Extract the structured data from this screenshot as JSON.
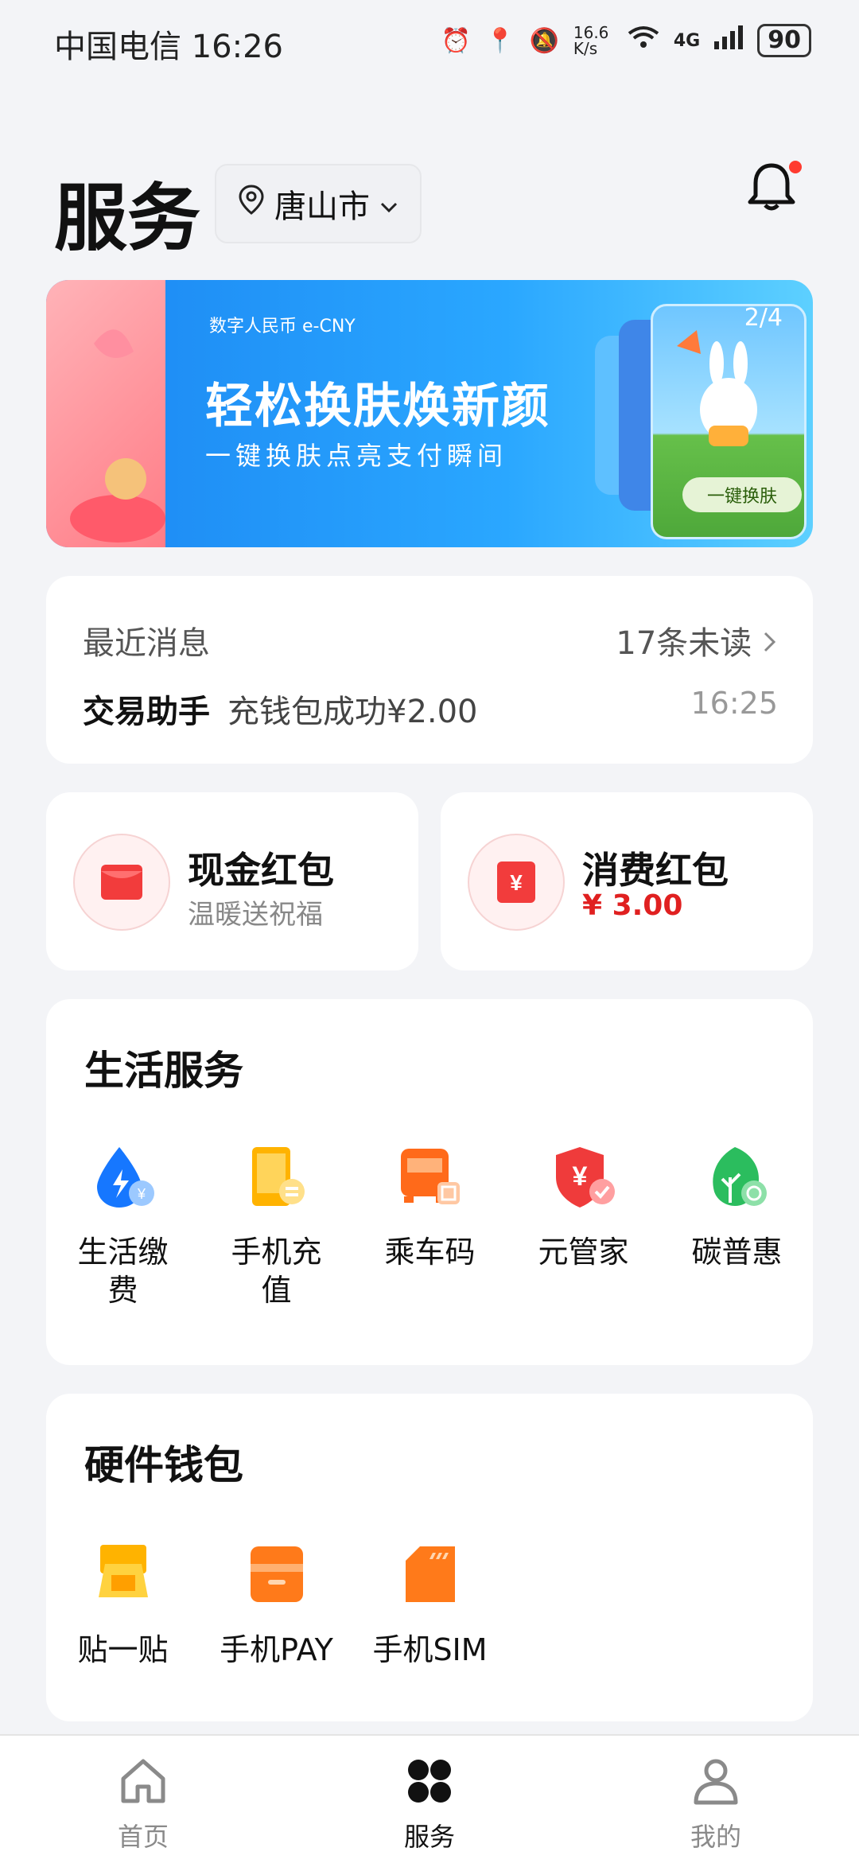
{
  "status_bar": {
    "carrier_time": "中国电信 16:26",
    "net_speed": "16.6 K/s",
    "signal": "4G",
    "battery": "90"
  },
  "header": {
    "title": "服务",
    "city": "唐山市"
  },
  "banner": {
    "brand": "数字人民币 e-CNY",
    "headline": "轻松换肤焕新颜",
    "subline": "一键换肤点亮支付瞬间",
    "pager": "2/4",
    "cta": "一键换肤"
  },
  "messages": {
    "label": "最近消息",
    "unread": "17条未读",
    "sender": "交易助手",
    "content": "充钱包成功¥2.00",
    "time": "16:25"
  },
  "red_packets": [
    {
      "title": "现金红包",
      "subtitle": "温暖送祝福"
    },
    {
      "title": "消费红包",
      "amount": "¥ 3.00"
    }
  ],
  "life_services": {
    "title": "生活服务",
    "items": [
      {
        "label": "生活缴费",
        "icon": "utility-payment-icon"
      },
      {
        "label": "手机充值",
        "icon": "phone-recharge-icon"
      },
      {
        "label": "乘车码",
        "icon": "bus-code-icon"
      },
      {
        "label": "元管家",
        "icon": "yuan-manager-icon"
      },
      {
        "label": "碳普惠",
        "icon": "carbon-leaf-icon"
      }
    ]
  },
  "hardware_wallet": {
    "title": "硬件钱包",
    "items": [
      {
        "label": "贴一贴",
        "icon": "tap-pay-icon"
      },
      {
        "label": "手机PAY",
        "icon": "phone-pay-icon"
      },
      {
        "label": "手机SIM",
        "icon": "sim-card-icon"
      }
    ]
  },
  "tabbar": {
    "tabs": [
      {
        "label": "首页"
      },
      {
        "label": "服务"
      },
      {
        "label": "我的"
      }
    ],
    "active": "服务"
  },
  "colors": {
    "accent_red": "#e02020",
    "background": "#f3f4f7"
  }
}
